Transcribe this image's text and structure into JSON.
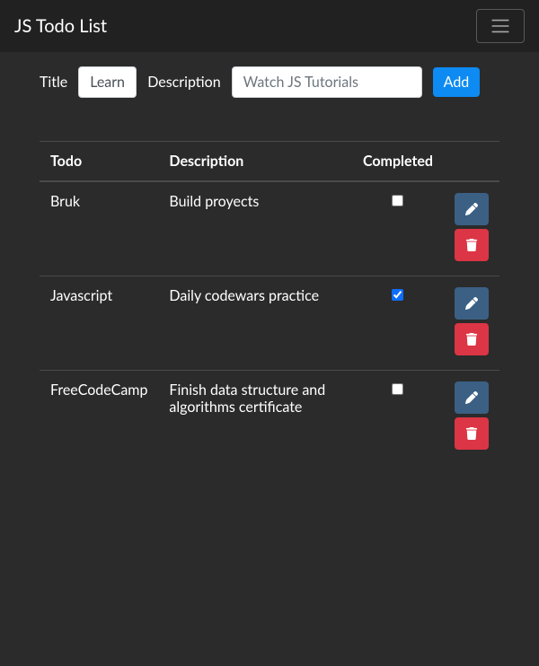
{
  "navbar": {
    "brand": "JS Todo List"
  },
  "form": {
    "title_label": "Title",
    "title_value": "Learn",
    "description_label": "Description",
    "description_placeholder": "Watch JS Tutorials",
    "add_label": "Add"
  },
  "table": {
    "headers": {
      "todo": "Todo",
      "description": "Description",
      "completed": "Completed"
    },
    "rows": [
      {
        "todo": "Bruk",
        "description": "Build proyects",
        "completed": false
      },
      {
        "todo": "Javascript",
        "description": "Daily codewars practice",
        "completed": true
      },
      {
        "todo": "FreeCodeCamp",
        "description": "Finish data structure and algorithms certificate",
        "completed": false
      }
    ]
  }
}
